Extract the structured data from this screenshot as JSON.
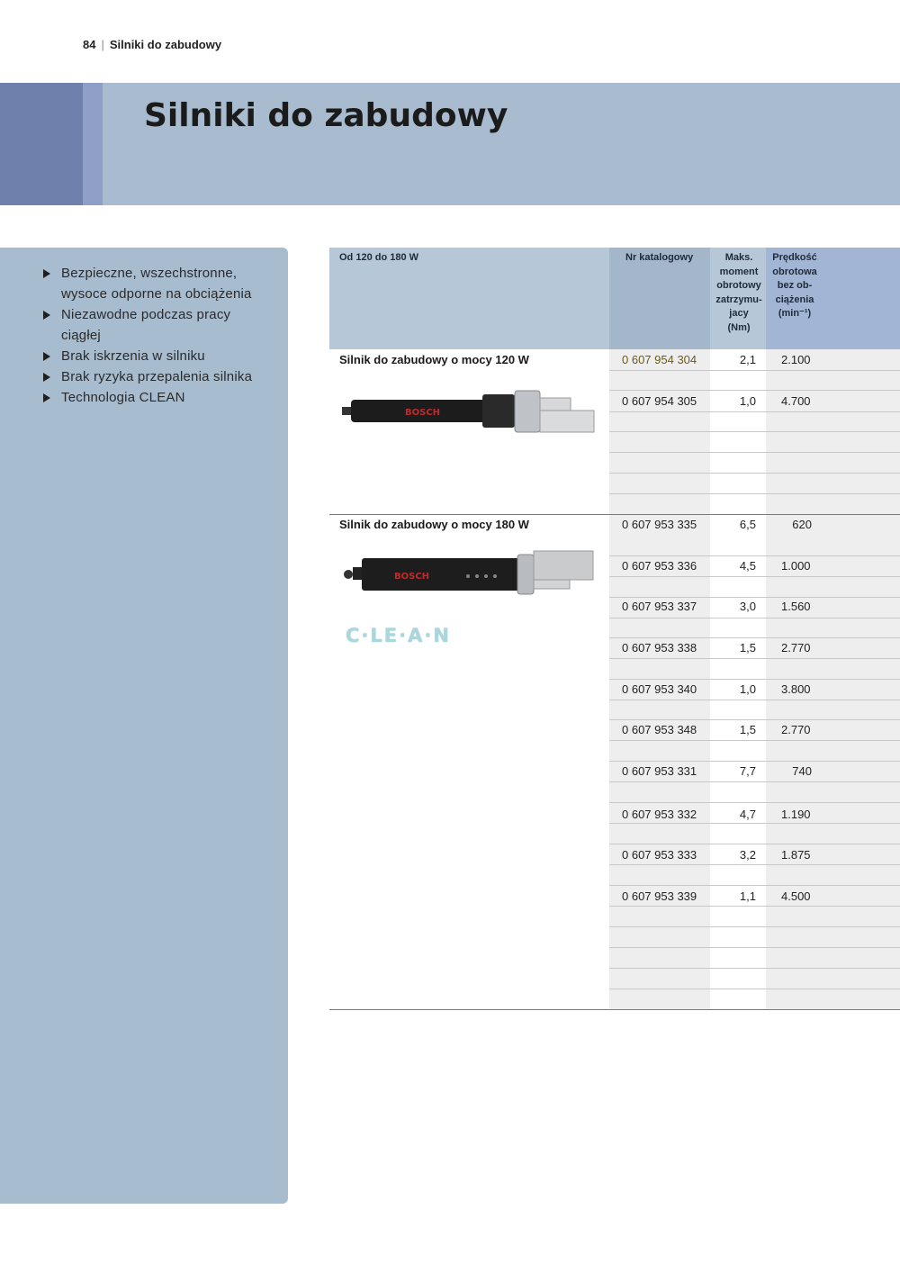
{
  "running_head": {
    "page_number": "84",
    "separator": "|",
    "section": "Silniki do zabudowy"
  },
  "banner": {
    "title": "Silniki do zabudowy"
  },
  "features": [
    "Bezpieczne, wszechstronne,",
    "wysoce odporne na obciążenia",
    "Niezawodne podczas pracy",
    "ciągłej",
    "Brak iskrzenia w silniku",
    "Brak ryzyka przepalenia silnika",
    "Technologia CLEAN"
  ],
  "table": {
    "headers": {
      "range": "Od 120 do 180 W",
      "catalog": "Nr katalogowy",
      "torque_lines": [
        "Maks.",
        "moment",
        "obrotowy",
        "zatrzymu-",
        "jacy",
        "(Nm)"
      ],
      "speed_lines": [
        "Prędkość",
        "obrotowa",
        "bez ob-",
        "ciążenia",
        "(min⁻¹)"
      ]
    },
    "sections": [
      {
        "title": "Silnik do zabudowy o mocy 120 W",
        "rows": [
          {
            "catalog": "0 607 954 304",
            "torque": "2,1",
            "speed": "2.100"
          },
          {
            "catalog": "0 607 954 305",
            "torque": "1,0",
            "speed": "4.700"
          }
        ]
      },
      {
        "title": "Silnik do zabudowy o mocy 180 W",
        "logo": "C·LE·A·N",
        "rows": [
          {
            "catalog": "0 607 953 335",
            "torque": "6,5",
            "speed": "620"
          },
          {
            "catalog": "0 607 953 336",
            "torque": "4,5",
            "speed": "1.000"
          },
          {
            "catalog": "0 607 953 337",
            "torque": "3,0",
            "speed": "1.560"
          },
          {
            "catalog": "0 607 953 338",
            "torque": "1,5",
            "speed": "2.770"
          },
          {
            "catalog": "0 607 953 340",
            "torque": "1,0",
            "speed": "3.800"
          },
          {
            "catalog": "0 607 953 348",
            "torque": "1,5",
            "speed": "2.770"
          },
          {
            "catalog": "0 607 953 331",
            "torque": "7,7",
            "speed": "740"
          },
          {
            "catalog": "0 607 953 332",
            "torque": "4,7",
            "speed": "1.190"
          },
          {
            "catalog": "0 607 953 333",
            "torque": "3,2",
            "speed": "1.875"
          },
          {
            "catalog": "0 607 953 339",
            "torque": "1,1",
            "speed": "4.500"
          }
        ]
      }
    ]
  },
  "product_images": [
    "bosch-motor-120w-image",
    "bosch-motor-180w-image"
  ],
  "brand_text": "BOSCH",
  "colors": {
    "banner": "#a9bccf",
    "accent_dark": "#6f80ad",
    "accent_light": "#8f9fc8",
    "header_cell": "#a9bccf"
  }
}
